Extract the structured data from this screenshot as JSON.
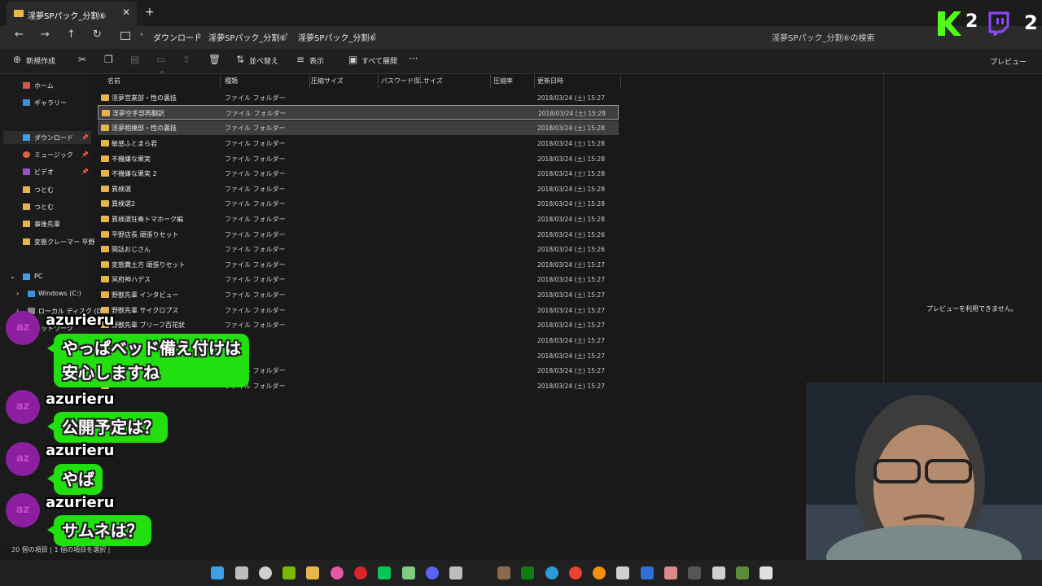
{
  "window": {
    "tab_title": "淫夢SPパック_分割⑥",
    "tab_close": "✕",
    "tab_add": "+"
  },
  "nav": {
    "back": "←",
    "forward": "→",
    "up": "↑",
    "refresh": "↻",
    "breadcrumbs": [
      "ダウンロード",
      "淫夢SPパック_分割⑥",
      "淫夢SPパック_分割⑥"
    ],
    "search_placeholder": "淫夢SPパック_分割⑥の検索"
  },
  "toolbar": {
    "new_label": "新規作成",
    "sort_label": "並べ替え",
    "view_label": "表示",
    "extract_label": "すべて展開",
    "more_label": "···",
    "preview_label": "プレビュー"
  },
  "sidebar": {
    "items": [
      {
        "label": "ホーム",
        "icon": "home-icon",
        "color": "#d9534f"
      },
      {
        "label": "ギャラリー",
        "icon": "gallery-icon",
        "color": "#3d8fe0"
      },
      {
        "label": "ダウンロード",
        "icon": "download-icon",
        "color": "#3aa0e8"
      },
      {
        "label": "ミュージック",
        "icon": "music-icon",
        "color": "#e0603b"
      },
      {
        "label": "ビデオ",
        "icon": "video-icon",
        "color": "#9b4fd0"
      },
      {
        "label": "つとむ",
        "icon": "folder-icon",
        "color": "#e6b44a"
      },
      {
        "label": "つとむ",
        "icon": "folder-icon",
        "color": "#e6b44a"
      },
      {
        "label": "事後先輩",
        "icon": "folder-icon",
        "color": "#e6b44a"
      },
      {
        "label": "変態クレーマー 平野",
        "icon": "folder-icon",
        "color": "#e6b44a"
      }
    ],
    "pc_label": "PC",
    "drives": [
      "Windows (C:)",
      "ローカル ディスク (D:"
    ],
    "network_label": "ネットワーク"
  },
  "columns": [
    "名前",
    "種類",
    "圧縮サイズ",
    "パスワード保...",
    "サイズ",
    "圧縮率",
    "更新日時"
  ],
  "files": [
    {
      "name": "淫夢営業部・性の裏技",
      "type": "ファイル フォルダー",
      "date": "2018/03/24 (土) 15:27"
    },
    {
      "name": "淫夢空手部再翻訳",
      "type": "ファイル フォルダー",
      "date": "2018/03/24 (土) 15:28"
    },
    {
      "name": "淫夢相撲部・性の裏技",
      "type": "ファイル フォルダー",
      "date": "2018/03/24 (土) 15:28"
    },
    {
      "name": "敏感ふとまら君",
      "type": "ファイル フォルダー",
      "date": "2018/03/24 (土) 15:28"
    },
    {
      "name": "不機嫌な果実",
      "type": "ファイル フォルダー",
      "date": "2018/03/24 (土) 15:28"
    },
    {
      "name": "不機嫌な果実 2",
      "type": "ファイル フォルダー",
      "date": "2018/03/24 (土) 15:28"
    },
    {
      "name": "異検選",
      "type": "ファイル フォルダー",
      "date": "2018/03/24 (土) 15:28"
    },
    {
      "name": "異検選2",
      "type": "ファイル フォルダー",
      "date": "2018/03/24 (土) 15:28"
    },
    {
      "name": "異検選狂奏トマホーク編",
      "type": "ファイル フォルダー",
      "date": "2018/03/24 (土) 15:28"
    },
    {
      "name": "平野店長 頑張りセット",
      "type": "ファイル フォルダー",
      "date": "2018/03/24 (土) 15:26"
    },
    {
      "name": "間話おじさん",
      "type": "ファイル フォルダー",
      "date": "2018/03/24 (土) 15:26"
    },
    {
      "name": "変態糞土方 頑張りセット",
      "type": "ファイル フォルダー",
      "date": "2018/03/24 (土) 15:27"
    },
    {
      "name": "冥府神ハデス",
      "type": "ファイル フォルダー",
      "date": "2018/03/24 (土) 15:27"
    },
    {
      "name": "野獣先輩 インタビュー",
      "type": "ファイル フォルダー",
      "date": "2018/03/24 (土) 15:27"
    },
    {
      "name": "野獣先輩 サイクロプス",
      "type": "ファイル フォルダー",
      "date": "2018/03/24 (土) 15:27"
    },
    {
      "name": "野獣先輩 ブリーフ百花狀",
      "type": "ファイル フォルダー",
      "date": "2018/03/24 (土) 15:27"
    },
    {
      "name": "",
      "type": "",
      "date": "2018/03/24 (土) 15:27"
    },
    {
      "name": "",
      "type": "",
      "date": "2018/03/24 (土) 15:27"
    },
    {
      "name": "",
      "type": "ファイル フォルダー",
      "date": "2018/03/24 (土) 15:27"
    },
    {
      "name": "",
      "type": "ファイル フォルダー",
      "date": "2018/03/24 (土) 15:27"
    }
  ],
  "preview_message": "プレビューを利用できません。",
  "status_text": "20 個の項目 | 1 個の項目を選択 |",
  "chat": [
    {
      "user": "azurieru",
      "avatar_text": "az",
      "message_lines": [
        "やっぱベッド備え付けは",
        "安心しますね"
      ]
    },
    {
      "user": "azurieru",
      "avatar_text": "az",
      "message_lines": [
        "公開予定は？"
      ]
    },
    {
      "user": "azurieru",
      "avatar_text": "az",
      "message_lines": [
        "やば"
      ]
    },
    {
      "user": "azurieru",
      "avatar_text": "az",
      "message_lines": [
        "サムネは？"
      ]
    }
  ],
  "overlay": {
    "k_count": "2",
    "twitch_count": "2",
    "k_color": "#53fc18",
    "twitch_color": "#9146ff"
  }
}
